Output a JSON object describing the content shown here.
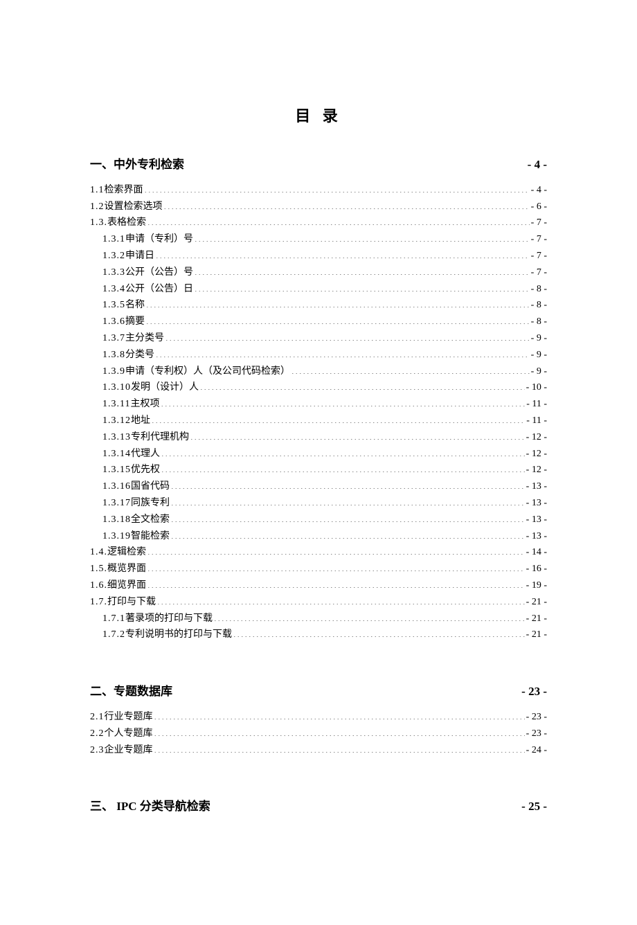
{
  "title": "目 录",
  "sections": [
    {
      "heading": {
        "label": "一、中外专利检索",
        "page": "- 4 -"
      },
      "entries": [
        {
          "level": 1,
          "num": "1.1",
          "label": "检索界面",
          "page": "- 4 -"
        },
        {
          "level": 1,
          "num": "1.2",
          "label": "设置检索选项",
          "page": "- 6 -"
        },
        {
          "level": 1,
          "num": "1.3.",
          "label": "表格检索",
          "page": "- 7 -"
        },
        {
          "level": 2,
          "num": "1.3.1",
          "label": "申请（专利）号",
          "page": "- 7 -"
        },
        {
          "level": 2,
          "num": "1.3.2",
          "label": "申请日",
          "page": "- 7 -"
        },
        {
          "level": 2,
          "num": "1.3.3",
          "label": "公开（公告）号",
          "page": "- 7 -"
        },
        {
          "level": 2,
          "num": "1.3.4",
          "label": "公开（公告）日",
          "page": "- 8 -"
        },
        {
          "level": 2,
          "num": "1.3.5",
          "label": "名称",
          "page": "- 8 -"
        },
        {
          "level": 2,
          "num": "1.3.6",
          "label": "摘要",
          "page": "- 8 -"
        },
        {
          "level": 2,
          "num": "1.3.7",
          "label": "主分类号",
          "page": "- 9 -"
        },
        {
          "level": 2,
          "num": "1.3.8",
          "label": "分类号",
          "page": "- 9 -"
        },
        {
          "level": 2,
          "num": "1.3.9",
          "label": "申请（专利权）人（及公司代码检索）",
          "page": "- 9 -"
        },
        {
          "level": 2,
          "num": "1.3.10",
          "label": "发明（设计）人",
          "page": "- 10 -"
        },
        {
          "level": 2,
          "num": "1.3.11",
          "label": "主权项",
          "page": "- 11 -"
        },
        {
          "level": 2,
          "num": "1.3.12",
          "label": "地址",
          "page": "- 11 -"
        },
        {
          "level": 2,
          "num": "1.3.13",
          "label": "专利代理机构",
          "page": "- 12 -"
        },
        {
          "level": 2,
          "num": "1.3.14",
          "label": "代理人",
          "page": "- 12 -"
        },
        {
          "level": 2,
          "num": "1.3.15",
          "label": "优先权",
          "page": "- 12 -"
        },
        {
          "level": 2,
          "num": "1.3.16",
          "label": "国省代码",
          "page": "- 13 -"
        },
        {
          "level": 2,
          "num": "1.3.17",
          "label": "同族专利",
          "page": "- 13 -"
        },
        {
          "level": 2,
          "num": "1.3.18",
          "label": "全文检索",
          "page": "- 13 -"
        },
        {
          "level": 2,
          "num": "1.3.19",
          "label": "智能检索",
          "page": "- 13 -"
        },
        {
          "level": 1,
          "num": "1.4.",
          "label": "逻辑检索",
          "page": "- 14 -"
        },
        {
          "level": 1,
          "num": "1.5.",
          "label": "概览界面",
          "page": "- 16 -"
        },
        {
          "level": 1,
          "num": "1.6.",
          "label": "细览界面",
          "page": "- 19 -"
        },
        {
          "level": 1,
          "num": "1.7.",
          "label": "打印与下载",
          "page": "- 21 -"
        },
        {
          "level": 2,
          "num": "1.7.1",
          "label": "著录项的打印与下载",
          "page": "- 21 -"
        },
        {
          "level": 2,
          "num": "1.7.2",
          "label": "专利说明书的打印与下载",
          "page": "- 21 -"
        }
      ]
    },
    {
      "heading": {
        "label": "二、专题数据库",
        "page": "- 23 -"
      },
      "entries": [
        {
          "level": 1,
          "num": "2.1",
          "label": "行业专题库",
          "page": "- 23 -"
        },
        {
          "level": 1,
          "num": "2.2",
          "label": "个人专题库",
          "page": "- 23 -"
        },
        {
          "level": 1,
          "num": "2.3",
          "label": "企业专题库",
          "page": "- 24 -"
        }
      ]
    },
    {
      "heading": {
        "label": "三、 IPC 分类导航检索",
        "page": "- 25 -"
      },
      "entries": []
    }
  ]
}
